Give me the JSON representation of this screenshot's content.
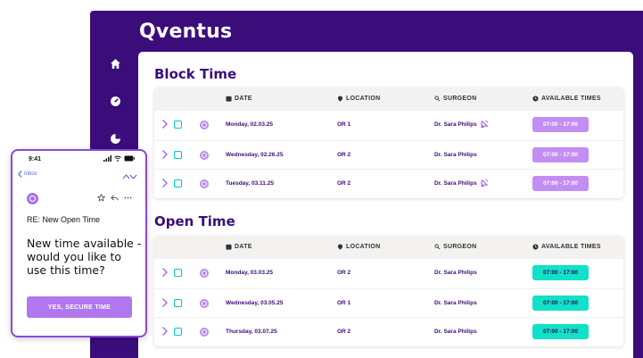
{
  "app": {
    "brand": "Qventus"
  },
  "nav": [
    {
      "icon": "home-icon"
    },
    {
      "icon": "dashboard-gauge-icon"
    },
    {
      "icon": "pie-chart-icon"
    }
  ],
  "columns": {
    "date": "DATE",
    "location": "LOCATION",
    "surgeon": "SURGEON",
    "times": "AVAILABLE TIMES"
  },
  "block_time": {
    "title": "Block Time",
    "pill_color": "#c38ef3",
    "rows": [
      {
        "date": "Monday, 02.03.25",
        "location": "OR 1",
        "surgeon": "Dr. Sara Philips",
        "times": "07:00 - 17:00",
        "badge": true
      },
      {
        "date": "Wednesday, 02.26.25",
        "location": "OR 2",
        "surgeon": "Dr. Sara Philips",
        "times": "07:00 - 17:00",
        "badge": false
      },
      {
        "date": "Tuesday, 03.11.25",
        "location": "OR 2",
        "surgeon": "Dr. Sara Philips",
        "times": "07:00 - 17:00",
        "badge": true
      }
    ]
  },
  "open_time": {
    "title": "Open Time",
    "pill_color": "#12e0c8",
    "rows": [
      {
        "date": "Monday, 03.03.25",
        "location": "OR 2",
        "surgeon": "Dr. Sara Philips",
        "times": "07:00 - 17:00"
      },
      {
        "date": "Wednesday, 03.05.25",
        "location": "OR 1",
        "surgeon": "Dr. Sara Philips",
        "times": "07:00 - 17:00"
      },
      {
        "date": "Thursday, 03.07.25",
        "location": "OR 2",
        "surgeon": "Dr. Sara Philips",
        "times": "07:00 - 17:00"
      }
    ]
  },
  "phone": {
    "time": "9:41",
    "back_label": "Inbox",
    "subject": "RE: New Open Time",
    "headline": "New time available - would you like to use this time?",
    "button_label": "YES, SECURE TIME"
  },
  "colors": {
    "brand_purple": "#3b0d7a",
    "accent_teal": "#00c7c7",
    "accent_purple": "#b177ee"
  }
}
